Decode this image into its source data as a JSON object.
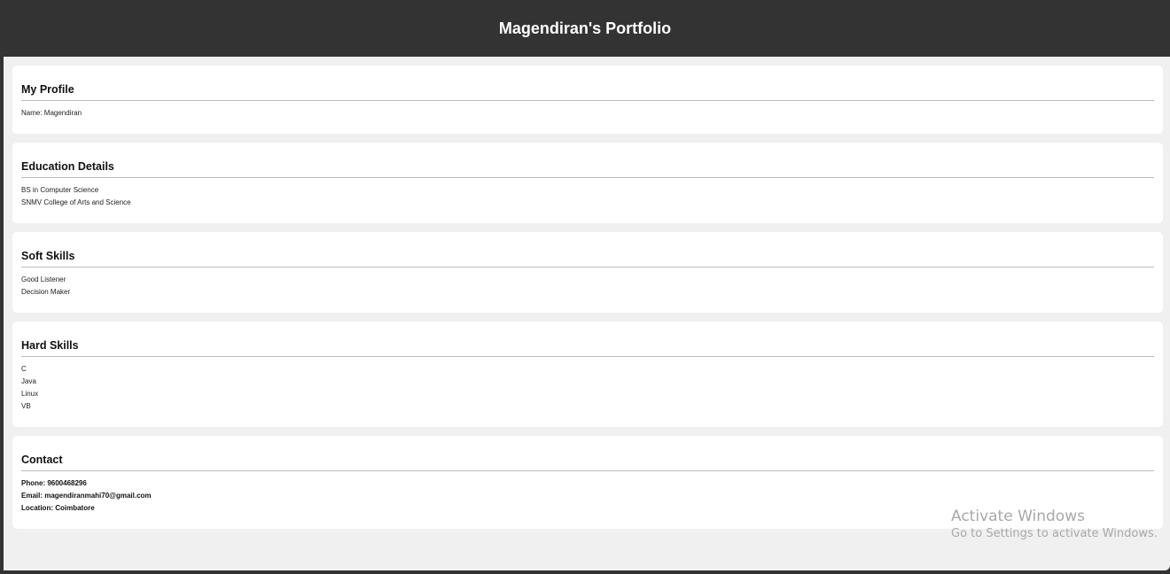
{
  "header": {
    "title": "Magendiran's Portfolio"
  },
  "sections": {
    "profile": {
      "title": "My Profile",
      "lines": [
        "Name: Magendiran"
      ]
    },
    "education": {
      "title": "Education Details",
      "lines": [
        "BS in Computer Science",
        "SNMV College of Arts and Science"
      ]
    },
    "soft_skills": {
      "title": "Soft Skills",
      "lines": [
        "Good Listener",
        "Decision Maker"
      ]
    },
    "hard_skills": {
      "title": "Hard Skills",
      "lines": [
        "C",
        "Java",
        "Linux",
        "VB"
      ]
    },
    "contact": {
      "title": "Contact",
      "lines": [
        "Phone: 9600468296",
        "Email: magendiranmahi70@gmail.com",
        "Location: Coimbatore"
      ]
    }
  },
  "watermark": {
    "line1": "Activate Windows",
    "line2": "Go to Settings to activate Windows."
  },
  "colors": {
    "header_bg": "#333333",
    "page_bg": "#f0f0f0",
    "card_bg": "#ffffff"
  }
}
